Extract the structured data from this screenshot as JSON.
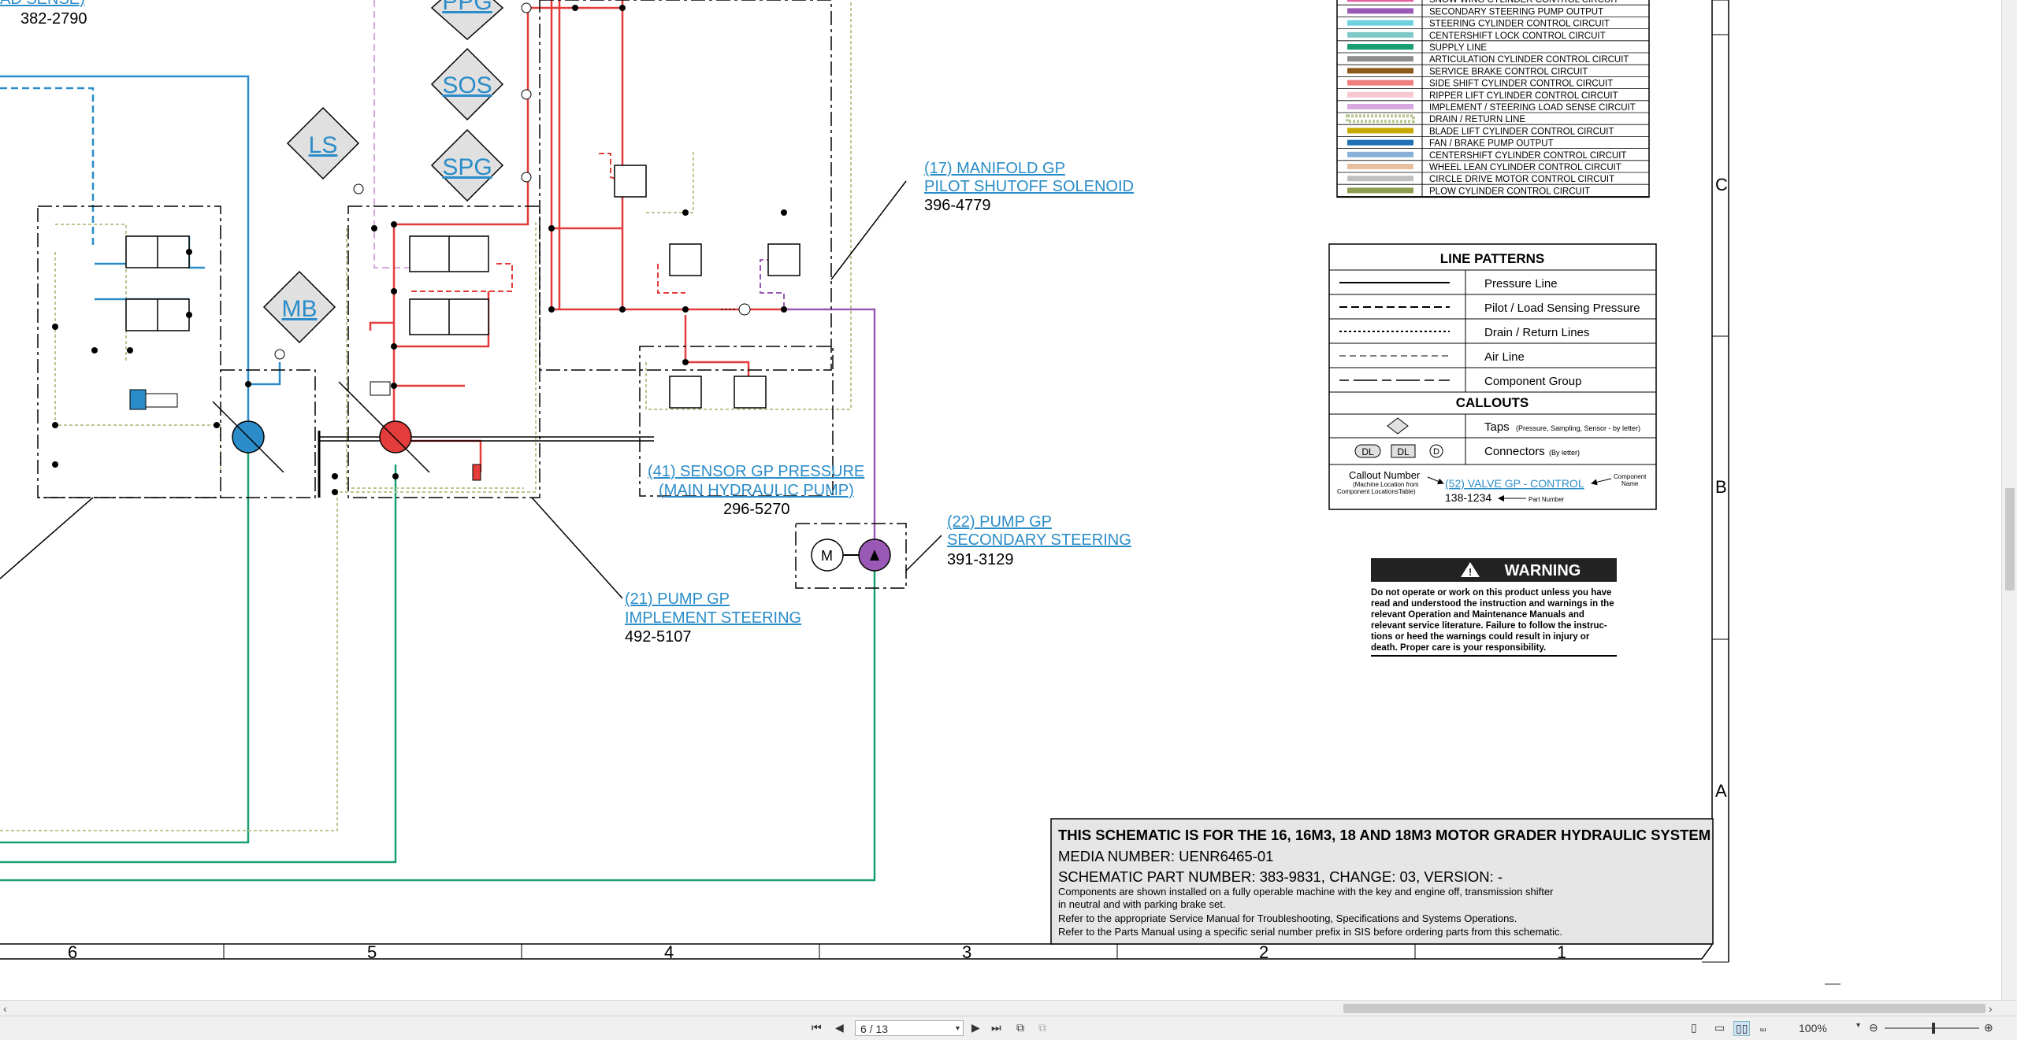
{
  "callouts": [
    {
      "id": "c-top",
      "title": "AD SENSE)",
      "part": "382-2790"
    },
    {
      "id": "c17",
      "line1": "(17) MANIFOLD GP",
      "line2": "PILOT SHUTOFF SOLENOID",
      "part": "396-4779"
    },
    {
      "id": "c41",
      "line1": "(41) SENSOR GP PRESSURE",
      "line2": "(MAIN HYDRAULIC PUMP)",
      "part": "296-5270"
    },
    {
      "id": "c22",
      "line1": "(22) PUMP GP",
      "line2": "SECONDARY STEERING",
      "part": "391-3129"
    },
    {
      "id": "c21",
      "line1": "(21) PUMP GP",
      "line2": "IMPLEMENT STEERING",
      "part": "492-5107"
    }
  ],
  "taps": [
    "PPG",
    "SOS",
    "SPG",
    "LS",
    "MB"
  ],
  "legend_colors": [
    {
      "label": "SNOW WING CYLINDER CONTROL CIRCUIT",
      "color": "#e060a0"
    },
    {
      "label": "SECONDARY STEERING PUMP OUTPUT",
      "color": "#9b59b6"
    },
    {
      "label": "STEERING CYLINDER CONTROL CIRCUIT",
      "color": "#6fd0e0"
    },
    {
      "label": "CENTERSHIFT LOCK CONTROL CIRCUIT",
      "color": "#7ec8c8"
    },
    {
      "label": "SUPPLY LINE",
      "color": "#1aa070"
    },
    {
      "label": "ARTICULATION CYLINDER CONTROL CIRCUIT",
      "color": "#8c8c8c"
    },
    {
      "label": "SERVICE BRAKE CONTROL CIRCUIT",
      "color": "#8b5a1a"
    },
    {
      "label": "SIDE SHIFT CYLINDER CONTROL CIRCUIT",
      "color": "#f08080"
    },
    {
      "label": "RIPPER LIFT CYLINDER CONTROL CIRCUIT",
      "color": "#f8c8d0"
    },
    {
      "label": "IMPLEMENT / STEERING LOAD SENSE CIRCUIT",
      "color": "#d8a8e0"
    },
    {
      "label": "DRAIN / RETURN LINE",
      "color": "#b8c890"
    },
    {
      "label": "BLADE LIFT CYLINDER CONTROL CIRCUIT",
      "color": "#c8a800"
    },
    {
      "label": "FAN / BRAKE PUMP OUTPUT",
      "color": "#1e6fb4"
    },
    {
      "label": "CENTERSHIFT CYLINDER CONTROL CIRCUIT",
      "color": "#88b0d8"
    },
    {
      "label": "WHEEL LEAN CYLINDER CONTROL CIRCUIT",
      "color": "#e8c0a0"
    },
    {
      "label": "CIRCLE DRIVE MOTOR CONTROL CIRCUIT",
      "color": "#c0c0c0"
    },
    {
      "label": "PLOW CYLINDER CONTROL CIRCUIT",
      "color": "#8c9c50"
    }
  ],
  "line_patterns": {
    "title": "LINE PATTERNS",
    "items": [
      "Pressure Line",
      "Pilot / Load Sensing Pressure",
      "Drain / Return Lines",
      "Air Line",
      "Component Group"
    ]
  },
  "callouts_legend": {
    "title": "CALLOUTS",
    "taps_label": "Taps",
    "taps_note": "(Pressure, Sampling, Sensor - by letter)",
    "connectors_label": "Connectors",
    "connectors_note": "(By letter)",
    "conn_a": "DL",
    "conn_b": "DL",
    "conn_c": "D",
    "callout_number": "Callout Number",
    "callout_sub1": "(Machine Location from",
    "callout_sub2": "Component LocationsTable)",
    "example_link": "(52) VALVE GP - CONTROL",
    "example_part": "138-1234",
    "component_name1": "Component",
    "component_name2": "Name",
    "part_number": "Part Number"
  },
  "warning": {
    "title": "WARNING",
    "lines": [
      "Do not operate or work on this product unless you have",
      "read and understood the instruction and warnings in the",
      "relevant Operation and Maintenance Manuals and",
      "relevant service literature. Failure to follow the instruc-",
      "tions or heed the warnings could result in injury or",
      "death. Proper care is your responsibility."
    ]
  },
  "title_block": {
    "title": "THIS SCHEMATIC IS FOR THE 16, 16M3, 18 AND 18M3 MOTOR GRADER HYDRAULIC SYSTEM",
    "media": "MEDIA NUMBER: UENR6465-01",
    "part": "SCHEMATIC PART NUMBER: 383-9831, CHANGE: 03, VERSION: -",
    "notes": [
      "Components are shown installed on a fully operable machine with the key and engine off, transmission shifter",
      "in neutral and with parking brake set.",
      "Refer to the appropriate Service Manual for Troubleshooting, Specifications and Systems Operations.",
      "Refer to the Parts Manual using a specific serial number prefix in SIS before ordering parts from this schematic."
    ]
  },
  "grid_columns": [
    "6",
    "5",
    "4",
    "3",
    "2",
    "1"
  ],
  "grid_rows": [
    "C",
    "B",
    "A"
  ],
  "viewer": {
    "page_value": "6 / 13",
    "zoom": "100%"
  }
}
